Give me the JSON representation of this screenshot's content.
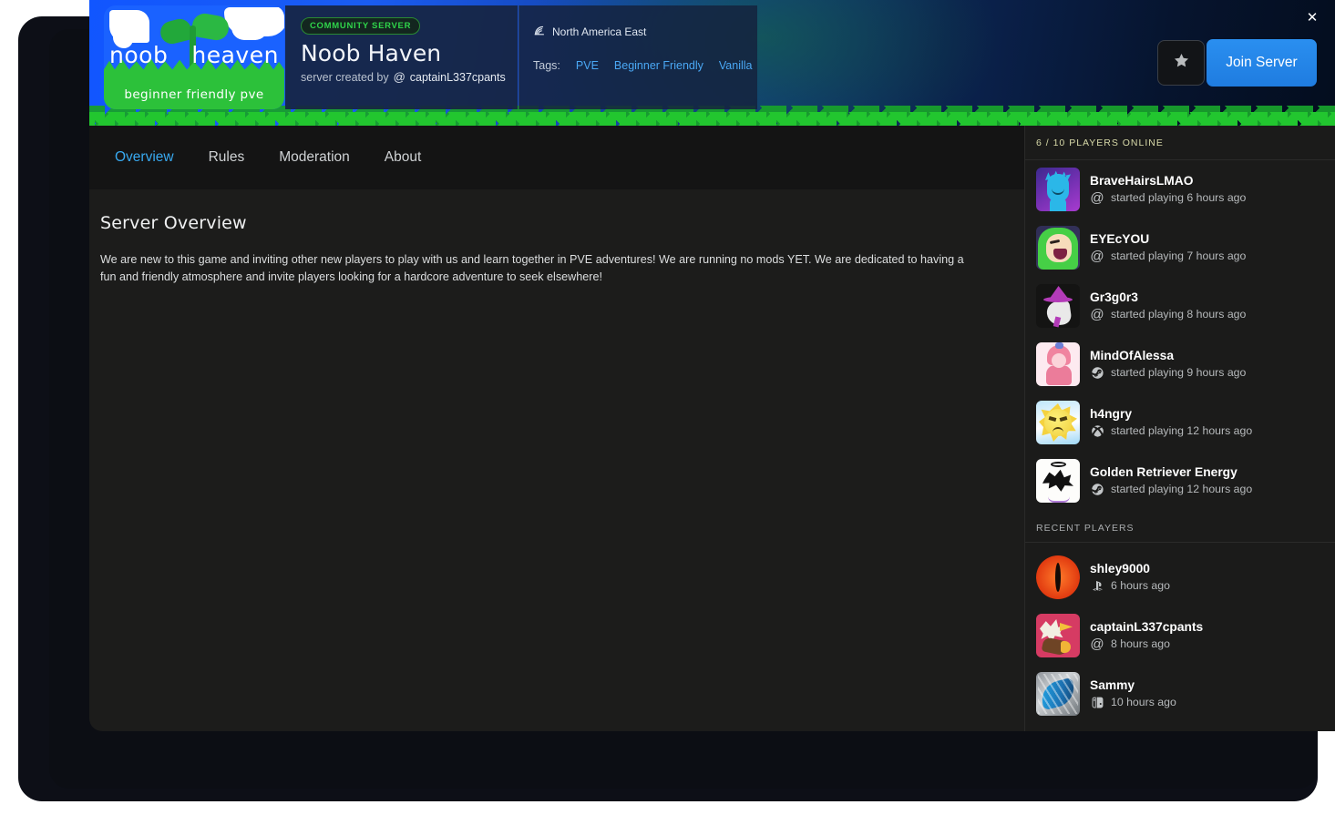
{
  "window": {
    "close_label": "✕"
  },
  "banner": {
    "logo": {
      "word_left": "noob",
      "word_right": "heaven",
      "tagline": "beginner friendly pve"
    },
    "badge": "COMMUNITY SERVER",
    "server_name": "Noob Haven",
    "created_by_label": "server created by",
    "creator_platform_icon": "at-icon",
    "creator_name": "captainL337cpants",
    "region_icon": "signal-icon",
    "region": "North America East",
    "tags_label": "Tags:",
    "tags": [
      "PVE",
      "Beginner Friendly",
      "Vanilla"
    ],
    "favorite_icon": "star-icon",
    "join_label": "Join Server",
    "accent_blue": "#2a8ff0",
    "badge_green": "#2fd44a"
  },
  "tabs": [
    {
      "label": "Overview",
      "active": true
    },
    {
      "label": "Rules",
      "active": false
    },
    {
      "label": "Moderation",
      "active": false
    },
    {
      "label": "About",
      "active": false
    }
  ],
  "overview": {
    "heading": "Server Overview",
    "description": "We are new to this game and inviting other new players to play with us and learn together in PVE adventures! We are running no mods YET. We are dedicated to having a fun and friendly atmosphere and invite players looking for a hardcore adventure to seek elsewhere!"
  },
  "sidebar": {
    "online_header": "6 / 10  PLAYERS ONLINE",
    "online_count": "6",
    "max_count": "10",
    "recent_header": "RECENT PLAYERS",
    "online_players": [
      {
        "name": "BraveHairsLMAO",
        "status": "started playing 6 hours ago",
        "platform_icon": "at-icon",
        "avatar": "av-brave"
      },
      {
        "name": "EYEcYOU",
        "status": "started playing 7 hours ago",
        "platform_icon": "at-icon",
        "avatar": "av-eye"
      },
      {
        "name": "Gr3g0r3",
        "status": "started playing 8 hours ago",
        "platform_icon": "at-icon",
        "avatar": "av-witch"
      },
      {
        "name": "MindOfAlessa",
        "status": "started playing 9 hours ago",
        "platform_icon": "steam-icon",
        "avatar": "av-alessa"
      },
      {
        "name": "h4ngry",
        "status": "started playing 12 hours ago",
        "platform_icon": "xbox-icon",
        "avatar": "av-sun"
      },
      {
        "name": "Golden Retriever Energy",
        "status": "started playing 12 hours ago",
        "platform_icon": "steam-icon",
        "avatar": "av-golden"
      }
    ],
    "recent_players": [
      {
        "name": "shley9000",
        "status": "6 hours ago",
        "platform_icon": "playstation-icon",
        "avatar": "av-eyeball"
      },
      {
        "name": "captainL337cpants",
        "status": "8 hours ago",
        "platform_icon": "at-icon",
        "avatar": "av-captain"
      },
      {
        "name": "Sammy",
        "status": "10 hours ago",
        "platform_icon": "switch-icon",
        "avatar": "av-sammy"
      }
    ]
  }
}
